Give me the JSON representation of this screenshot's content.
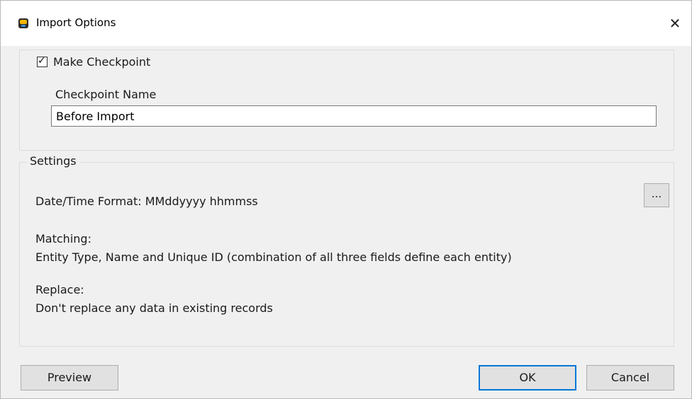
{
  "window": {
    "title": "Import Options",
    "close_label": "✕"
  },
  "checkpoint": {
    "checked": true,
    "checkbox_label": "Make Checkpoint",
    "name_label": "Checkpoint Name",
    "name_value": "Before Import"
  },
  "settings": {
    "legend": "Settings",
    "date_format": "Date/Time Format: MMddyyyy hhmmss",
    "browse_label": "...",
    "matching_label": "Matching:",
    "matching_value": "Entity Type, Name and Unique ID (combination of all three fields define each entity)",
    "replace_label": "Replace:",
    "replace_value": "Don't replace any data in existing records"
  },
  "buttons": {
    "preview": "Preview",
    "ok": "OK",
    "cancel": "Cancel"
  },
  "icons": {
    "app": "app-icon",
    "checkmark": "✓"
  },
  "colors": {
    "accent": "#0078d7",
    "dialog_bg": "#f0f0f0",
    "titlebar_bg": "#ffffff"
  }
}
